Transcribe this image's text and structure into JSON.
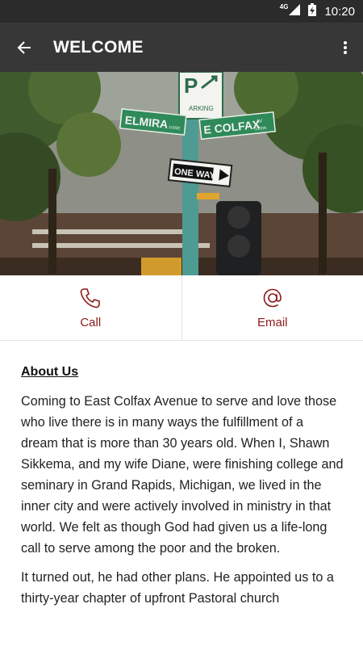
{
  "status_bar": {
    "network": "4G",
    "time": "10:20"
  },
  "app_bar": {
    "title": "WELCOME"
  },
  "hero": {
    "sign_street_1": "ELMIRA",
    "sign_street_1_num": "1500E",
    "sign_street_2": "E COLFAX",
    "sign_street_2_suffix": "AV",
    "sign_street_2_num": "1500N",
    "one_way": "ONE WAY",
    "parking_letter": "P",
    "parking_text": "ARKING"
  },
  "actions": [
    {
      "label": "Call",
      "icon": "phone-icon"
    },
    {
      "label": "Email",
      "icon": "at-icon"
    }
  ],
  "about": {
    "title": "About Us",
    "paragraphs": [
      "Coming to East Colfax Avenue to serve and love those who live there is in many ways the fulfillment of a dream that is more than 30 years old. When I, Shawn Sikkema, and my wife Diane, were finishing college and seminary in Grand Rapids, Michigan, we lived in the inner city and were actively involved in ministry in that world. We felt as though God had given us a life-long call to serve among the poor and the broken.",
      "It turned out, he had other plans. He appointed us to a thirty-year chapter of upfront Pastoral church"
    ]
  },
  "colors": {
    "status_bar": "#2b2b2b",
    "app_bar": "#373737",
    "accent": "#8b1a1a"
  }
}
